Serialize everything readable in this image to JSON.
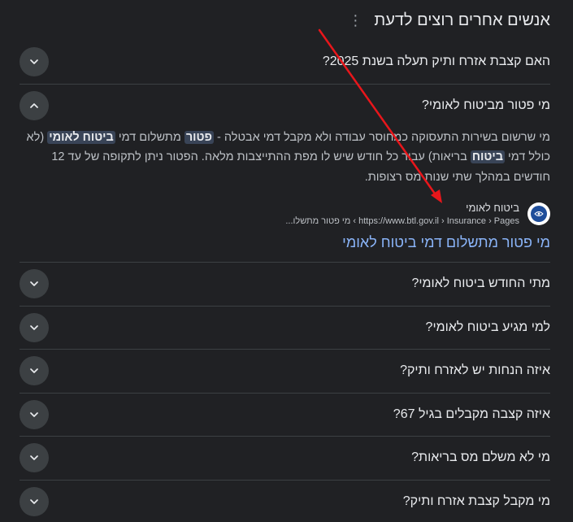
{
  "section": {
    "title": "אנשים אחרים רוצים לדעת",
    "menu_icon": "more-vert-icon"
  },
  "questions_before": [
    {
      "text": "האם קצבת אזרח ותיק תעלה בשנת 2025?"
    }
  ],
  "expanded": {
    "question": "מי פטור מביטוח לאומי?",
    "answer": {
      "part1": "מי שרשום בשירות התעסוקה כמחוסר עבודה ולא מקבל דמי אבטלה - ",
      "hl1": "פטור",
      "part2": " מתשלום דמי ",
      "hl2": "ביטוח לאומי",
      "part3": " (לא כולל דמי ",
      "hl3": "ביטוח",
      "part4": " בריאות) עבור כל חודש שיש לו מפת ההתייצבות מלאה. הפטור ניתן לתקופה של עד 12 חודשים במהלך שתי שנות מס רצופות."
    },
    "source": {
      "name": "ביטוח לאומי",
      "cite": "https://www.btl.gov.il › Insurance › Pages › מי פטור מתשלו...",
      "favicon": "btl-logo-icon"
    },
    "link_title": "מי פטור מתשלום דמי ביטוח לאומי"
  },
  "questions_after": [
    {
      "text": "מתי החודש ביטוח לאומי?"
    },
    {
      "text": "למי מגיע ביטוח לאומי?"
    },
    {
      "text": "איזה הנחות יש לאזרח ותיק?"
    },
    {
      "text": "איזה קצבה מקבלים בגיל 67?"
    },
    {
      "text": "מי לא משלם מס בריאות?"
    },
    {
      "text": "מי מקבל קצבת אזרח ותיק?"
    }
  ],
  "colors": {
    "background": "#202124",
    "text": "#e8eaed",
    "link": "#8ab4f8",
    "highlight": "#394457",
    "annotation_arrow": "#e8161b"
  }
}
